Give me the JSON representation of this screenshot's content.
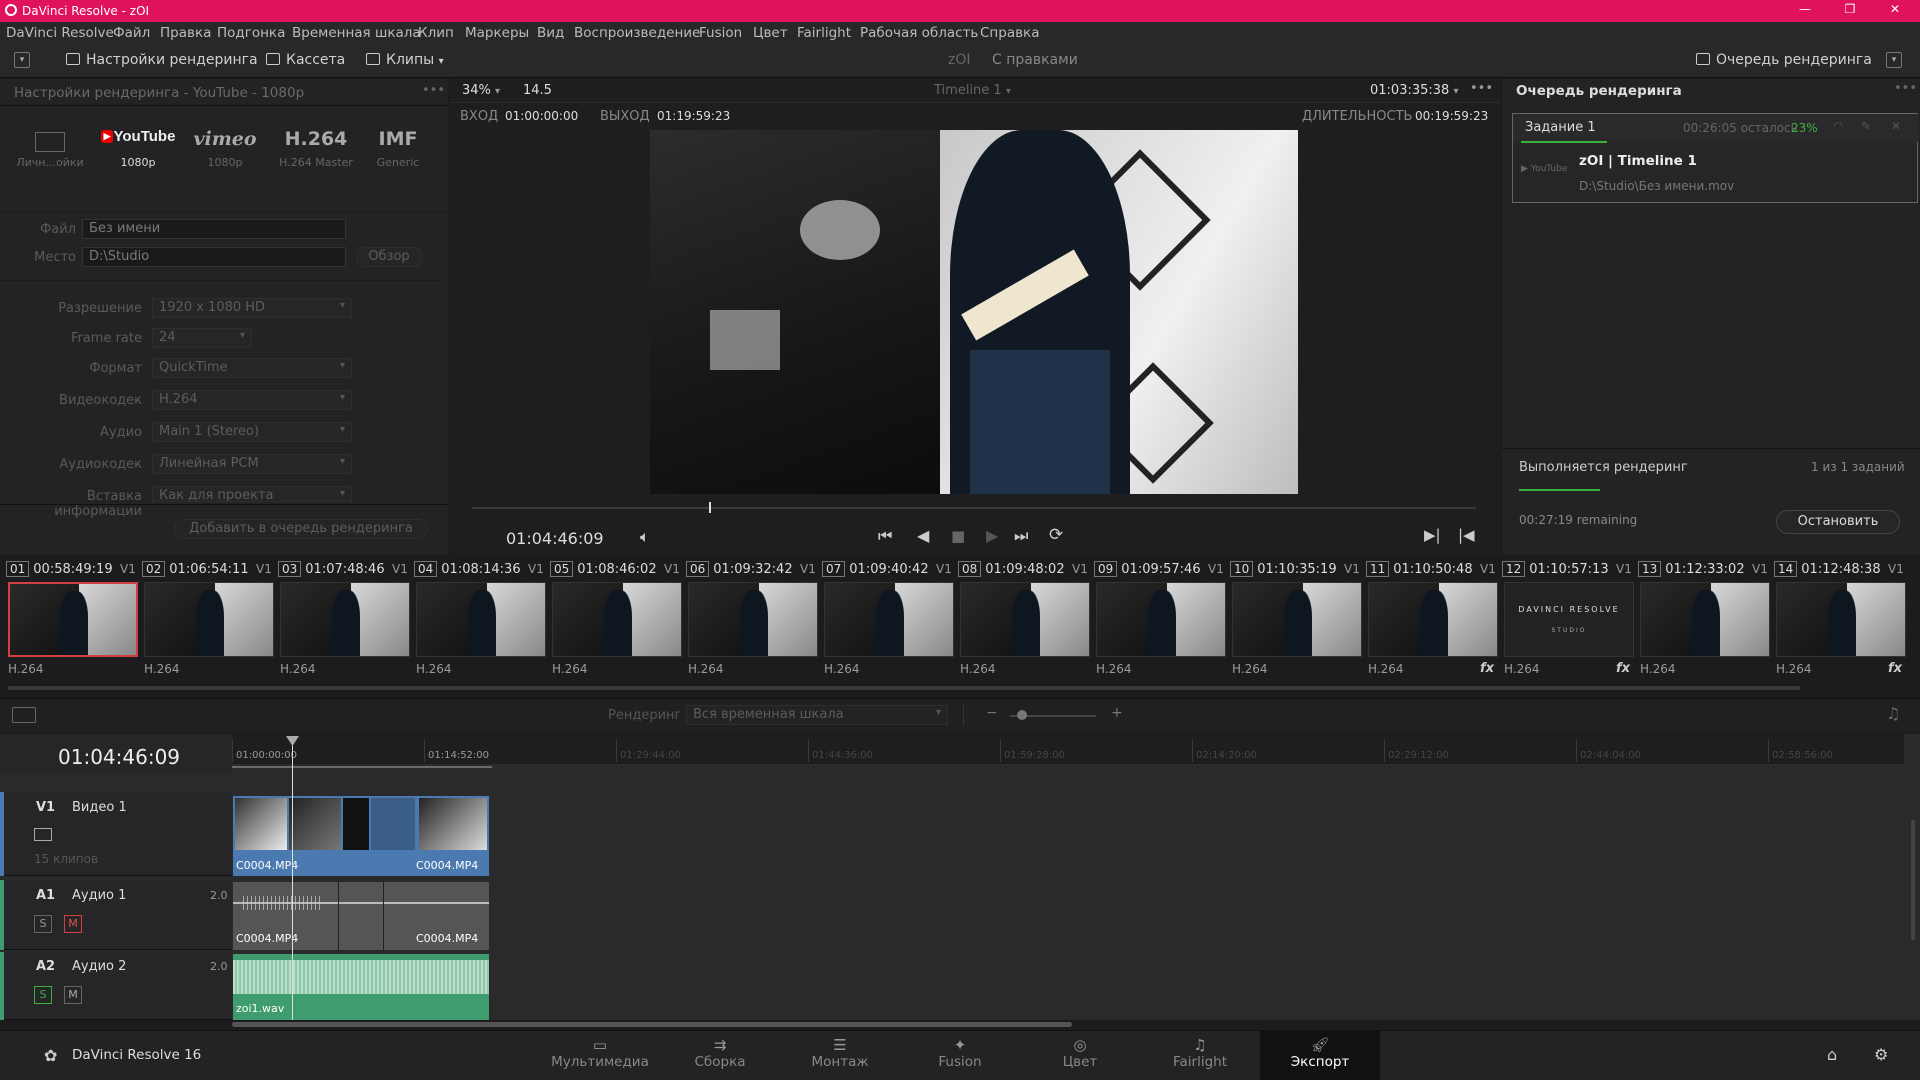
{
  "app": {
    "title": "DaVinci Resolve - zOI",
    "name": "DaVinci Resolve 16"
  },
  "menu": [
    "DaVinci Resolve",
    "Файл",
    "Правка",
    "Подгонка",
    "Временная шкала",
    "Клип",
    "Маркеры",
    "Вид",
    "Воспроизведение",
    "Fusion",
    "Цвет",
    "Fairlight",
    "Рабочая область",
    "Справка"
  ],
  "toolbar": {
    "render_settings": "Настройки рендеринга",
    "tape": "Кассета",
    "clips": "Клипы",
    "project": "zOI",
    "status": "С правками",
    "render_queue": "Очередь рендеринга"
  },
  "render_settings": {
    "title": "Настройки рендеринга - YouTube - 1080p",
    "presets": [
      {
        "name": "",
        "sub": "Личн...ойки"
      },
      {
        "name": "YouTube",
        "sub": "1080p"
      },
      {
        "name": "vimeo",
        "sub": "1080p"
      },
      {
        "name": "H.264",
        "sub": "H.264 Master"
      },
      {
        "name": "IMF",
        "sub": "Generic"
      }
    ],
    "file_label": "Файл",
    "file_value": "Без имени",
    "location_label": "Место",
    "location_value": "D:\\Studio",
    "browse": "Обзор",
    "rows": [
      {
        "label": "Разрешение",
        "value": "1920 x 1080 HD"
      },
      {
        "label": "Frame rate",
        "value": "24"
      },
      {
        "label": "Формат",
        "value": "QuickTime"
      },
      {
        "label": "Видеокодек",
        "value": "H.264"
      },
      {
        "label": "Аудио",
        "value": "Main 1 (Stereo)"
      },
      {
        "label": "Аудиокодек",
        "value": "Линейная PCM"
      },
      {
        "label": "Вставка информации",
        "value": "Как для проекта"
      }
    ],
    "add_to_queue": "Добавить в очередь рендеринга"
  },
  "viewer": {
    "zoom": "34%",
    "fps": "14.5",
    "timeline_name": "Timeline 1",
    "timecode_top": "01:03:35:38",
    "in_label": "ВХОД",
    "in_value": "01:00:00:00",
    "out_label": "ВЫХОД",
    "out_value": "01:19:59:23",
    "duration_label": "ДЛИТЕЛЬНОСТЬ",
    "duration_value": "00:19:59:23",
    "current_tc": "01:04:46:09",
    "scrub_position": 0.236
  },
  "queue": {
    "title": "Очередь рендеринга",
    "job_label": "Задание 1",
    "job_remaining": "00:26:05 осталось",
    "job_percent": "23%",
    "job_name": "zOI | Timeline 1",
    "job_path": "D:\\Studio\\Без имени.mov",
    "rendering_label": "Выполняется рендеринг",
    "count_label": "1 из 1 заданий",
    "remaining": "00:27:19 remaining",
    "stop": "Остановить",
    "progress": 0.23
  },
  "clips": [
    {
      "num": "01",
      "tc": "00:58:49:19",
      "track": "V1",
      "codec": "H.264",
      "fx": false,
      "selected": true
    },
    {
      "num": "02",
      "tc": "01:06:54:11",
      "track": "V1",
      "codec": "H.264",
      "fx": false,
      "selected": false
    },
    {
      "num": "03",
      "tc": "01:07:48:46",
      "track": "V1",
      "codec": "H.264",
      "fx": false,
      "selected": false
    },
    {
      "num": "04",
      "tc": "01:08:14:36",
      "track": "V1",
      "codec": "H.264",
      "fx": false,
      "selected": false
    },
    {
      "num": "05",
      "tc": "01:08:46:02",
      "track": "V1",
      "codec": "H.264",
      "fx": false,
      "selected": false
    },
    {
      "num": "06",
      "tc": "01:09:32:42",
      "track": "V1",
      "codec": "H.264",
      "fx": false,
      "selected": false
    },
    {
      "num": "07",
      "tc": "01:09:40:42",
      "track": "V1",
      "codec": "H.264",
      "fx": false,
      "selected": false
    },
    {
      "num": "08",
      "tc": "01:09:48:02",
      "track": "V1",
      "codec": "H.264",
      "fx": false,
      "selected": false
    },
    {
      "num": "09",
      "tc": "01:09:57:46",
      "track": "V1",
      "codec": "H.264",
      "fx": false,
      "selected": false
    },
    {
      "num": "10",
      "tc": "01:10:35:19",
      "track": "V1",
      "codec": "H.264",
      "fx": false,
      "selected": false
    },
    {
      "num": "11",
      "tc": "01:10:50:48",
      "track": "V1",
      "codec": "H.264",
      "fx": true,
      "selected": false
    },
    {
      "num": "12",
      "tc": "01:10:57:13",
      "track": "V1",
      "codec": "H.264",
      "fx": true,
      "selected": false
    },
    {
      "num": "13",
      "tc": "01:12:33:02",
      "track": "V1",
      "codec": "H.264",
      "fx": false,
      "selected": false
    },
    {
      "num": "14",
      "tc": "01:12:48:38",
      "track": "V1",
      "codec": "H.264",
      "fx": true,
      "selected": false
    }
  ],
  "clip12_title": "DAVINCI RESOLVE",
  "clip12_sub": "STUDIO",
  "timeline_bar": {
    "render_label": "Рендеринг",
    "render_value": "Вся временная шкала"
  },
  "timeline": {
    "timecode": "01:04:46:09",
    "ruler": [
      "01:00:00:00",
      "01:14:52:00",
      "01:29:44:00",
      "01:44:36:00",
      "01:59:28:00",
      "02:14:20:00",
      "02:29:12:00",
      "02:44:04:00",
      "02:58:56:00"
    ],
    "tracks": [
      {
        "id": "V1",
        "name": "Видео 1",
        "extra": "15 клипов",
        "clips": [
          "C0004.MP4",
          "C0004.MP4"
        ]
      },
      {
        "id": "A1",
        "name": "Аудио 1",
        "ch": "2.0",
        "clips": [
          "C0004.MP4",
          "C0004.MP4"
        ]
      },
      {
        "id": "A2",
        "name": "Аудио 2",
        "ch": "2.0",
        "clips": [
          "zoi1.wav"
        ]
      }
    ],
    "solo": "S",
    "mute": "M"
  },
  "pages": [
    "Мультимедиа",
    "Сборка",
    "Монтаж",
    "Fusion",
    "Цвет",
    "Fairlight",
    "Экспорт"
  ],
  "active_page": "Экспорт",
  "colors": {
    "titlebar": "#e0125e",
    "accent_green": "#3ab23a",
    "clip_blue": "#4a7ab0",
    "audio_green": "#3e9c6e",
    "selected_red": "#d04040"
  }
}
